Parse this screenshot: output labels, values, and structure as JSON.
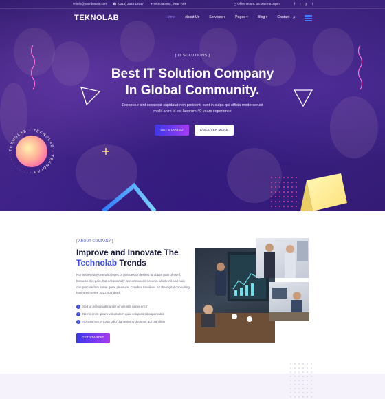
{
  "topbar": {
    "email": "info@yourdomain.com",
    "phone": "(0215) 2648 12547",
    "address": "Teknolab Inc., New York",
    "hours": "Office Hours: 08:00am-6:00pm",
    "socials": [
      "f",
      "t",
      "p",
      "i"
    ]
  },
  "nav": {
    "logo": "TEKNOLAB",
    "links": [
      "Home",
      "About Us",
      "Services ▾",
      "Pages ▾",
      "Blog ▾",
      "Contact"
    ],
    "search_icon": "⌕"
  },
  "hero": {
    "eyebrow": "[ IT SOLUTIONS ]",
    "title_line1": "Best IT Solution Company",
    "title_line2": "In Global Community.",
    "desc_line1": "Excepteur sint occaecat cupidatat non proident, sunt in culpa qui officia moderserunt",
    "desc_line2": "mollit anim id est laborum 40 years experience",
    "primary_button": "GET STARTED",
    "secondary_button": "DISCOVER MORE",
    "badge_text": "TEKNOLAB · TEKNOLAB · TEKNOLAB ·"
  },
  "about": {
    "eyebrow": "[ ABOUT COMPANY ]",
    "title_line1": "Improve and Innovate The",
    "title_accent": "Technolab",
    "title_rest": " Trends",
    "desc": "Nor is there anyone who loves or pursues or desires to obtain pain of itself, because it is pain, but occasionally circumstances occur in which toil and pain can procure him some great pleasure. Creabox timelines for the digital consulting business theme 2021 standard",
    "checks": [
      "Sed ut perspiciatis unde omnis iste natus error",
      "Nemo enim ipsam voluptatem quia voluptas sit aspernatur",
      "Accusamus et iusto odio dignissimos ducimus qui blanditiis"
    ],
    "button": "GET STARTED"
  },
  "colors": {
    "accent": "#3b4ce0",
    "gradient_start": "#3a37e6",
    "gradient_end": "#a63bf2",
    "hero_bg": "#3d2488"
  }
}
